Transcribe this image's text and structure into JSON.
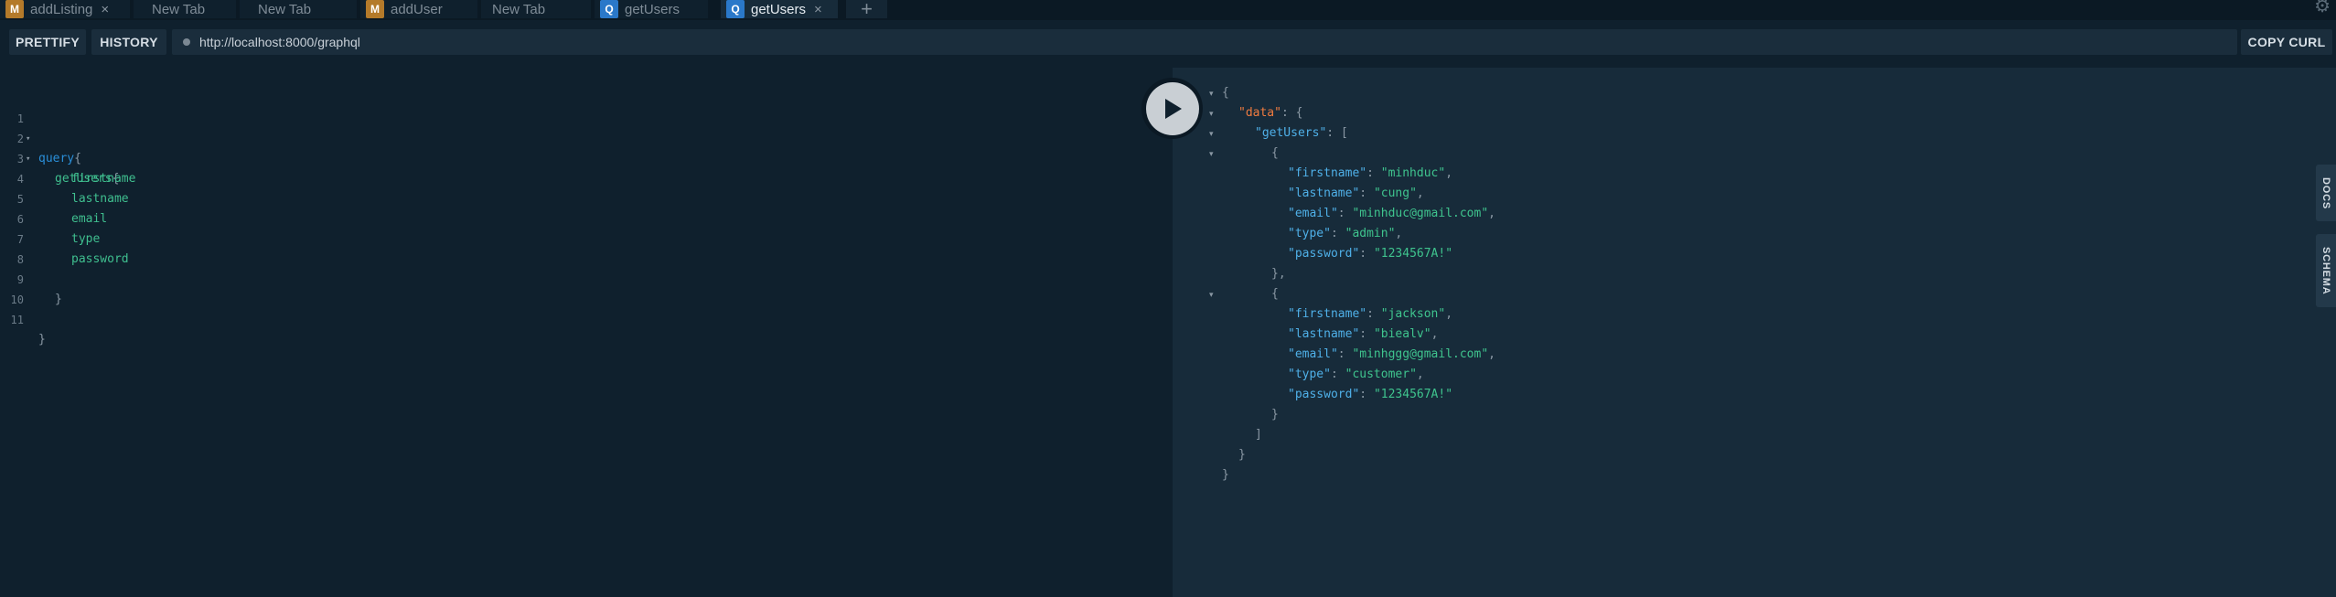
{
  "tabs": [
    {
      "label": "addListing",
      "badge": "M",
      "closable": true
    },
    {
      "label": "New Tab"
    },
    {
      "label": "New Tab"
    },
    {
      "label": "addUser",
      "badge": "M"
    },
    {
      "label": "New Tab"
    },
    {
      "label": "getUsers",
      "badge": "Q"
    },
    {
      "label": "getUsers",
      "badge": "Q",
      "active": true,
      "closable": true
    }
  ],
  "toolbar": {
    "prettify": "PRETTIFY",
    "history": "HISTORY",
    "url": "http://localhost:8000/graphql",
    "copy_curl": "COPY CURL"
  },
  "editor": {
    "line_numbers": [
      "1",
      "2",
      "3",
      "4",
      "5",
      "6",
      "7",
      "8",
      "9",
      "10",
      "11"
    ],
    "query_keyword": "query",
    "open_brace": "{",
    "close_brace": "}",
    "operation": "getUsers",
    "fields": [
      "firstname",
      "lastname",
      "email",
      "type",
      "password"
    ]
  },
  "result": {
    "open": "{",
    "close": "}",
    "data_key": "\"data\"",
    "getusers_key": "\"getUsers\"",
    "array_open": "[",
    "array_close": "]",
    "obj_open": "{",
    "obj_close": "}",
    "obj_close_comma": "},",
    "colon": ": ",
    "keys": {
      "firstname": "\"firstname\"",
      "lastname": "\"lastname\"",
      "email": "\"email\"",
      "type": "\"type\"",
      "password": "\"password\""
    },
    "users": [
      {
        "firstname": "\"minhduc\"",
        "lastname": "\"cung\"",
        "email": "\"minhduc@gmail.com\"",
        "type": "\"admin\"",
        "password": "\"1234567A!\""
      },
      {
        "firstname": "\"jackson\"",
        "lastname": "\"biealv\"",
        "email": "\"minhggg@gmail.com\"",
        "type": "\"customer\"",
        "password": "\"1234567A!\""
      }
    ]
  },
  "sidetabs": {
    "docs": "DOCS",
    "schema": "SCHEMA"
  },
  "icons": {
    "run": "play-icon",
    "add_tab": "plus-icon",
    "settings": "gear-icon",
    "close": "close-icon"
  }
}
